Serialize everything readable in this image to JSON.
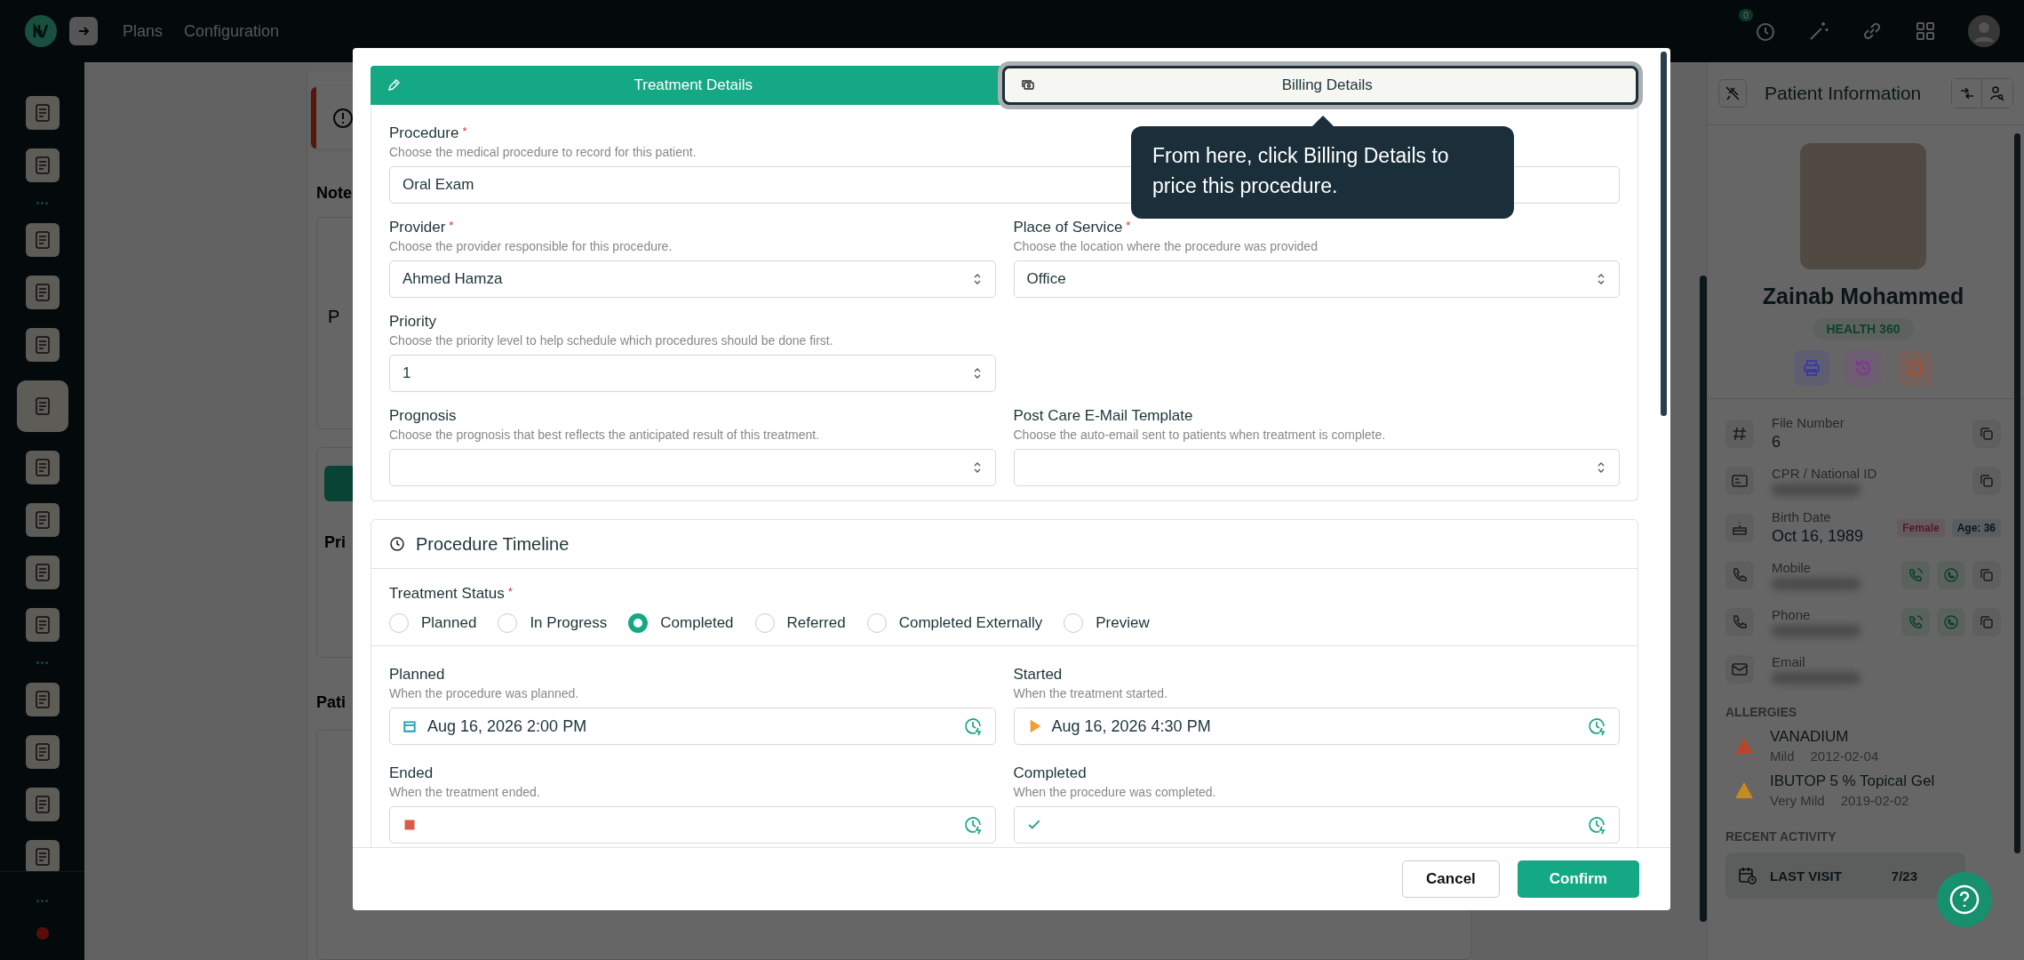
{
  "topbar": {
    "nav": [
      "Plans",
      "Configuration"
    ],
    "timer_badge": "0"
  },
  "sidebar": {
    "items": [
      {
        "kind": "icon",
        "selected": false
      },
      {
        "kind": "icon",
        "selected": false
      },
      {
        "kind": "separator"
      },
      {
        "kind": "icon",
        "selected": false
      },
      {
        "kind": "icon",
        "selected": false
      },
      {
        "kind": "icon",
        "selected": false
      },
      {
        "kind": "icon",
        "selected": true
      },
      {
        "kind": "icon",
        "selected": false
      },
      {
        "kind": "icon",
        "selected": false
      },
      {
        "kind": "icon",
        "selected": false
      },
      {
        "kind": "icon",
        "selected": false
      },
      {
        "kind": "separator"
      },
      {
        "kind": "icon",
        "selected": false
      },
      {
        "kind": "icon",
        "selected": false
      },
      {
        "kind": "icon",
        "selected": false
      },
      {
        "kind": "icon",
        "selected": false
      }
    ]
  },
  "background": {
    "note_label": "Note",
    "card_text": "P",
    "table_header": "Pri",
    "section_label": "Pati"
  },
  "modal": {
    "tabs": [
      {
        "label": "Treatment Details",
        "selected": true,
        "highlighted": false
      },
      {
        "label": "Billing Details",
        "selected": false,
        "highlighted": true
      }
    ],
    "tooltip": {
      "text": "From here, click Billing Details to price this procedure."
    },
    "rows": [
      [
        {
          "label": "Procedure",
          "required_mark": "*",
          "hint": "Choose the medical procedure to record for this patient.",
          "value": "Oral Exam",
          "kind": "text",
          "wide": true
        }
      ],
      [
        {
          "label": "Provider",
          "required_mark": "*",
          "hint": "Choose the provider responsible for this procedure.",
          "value": "Ahmed Hamza",
          "kind": "select",
          "wide": false
        },
        {
          "label": "Place of Service",
          "required_mark": "*",
          "hint": "Choose the location where the procedure was provided",
          "value": "Office",
          "kind": "select",
          "wide": false
        }
      ],
      [
        {
          "label": "Priority",
          "hint": "Choose the priority level to help schedule which procedures should be done first.",
          "value": "1",
          "kind": "select",
          "wide": false
        }
      ],
      [
        {
          "label": "Prognosis",
          "hint": "Choose the prognosis that best reflects the anticipated result of this treatment.",
          "kind": "select",
          "wide": false
        },
        {
          "label": "Post Care E-Mail Template",
          "hint": "Choose the auto-email sent to patients when treatment is complete.",
          "kind": "select",
          "wide": false
        }
      ]
    ],
    "timeline": {
      "title": "Procedure Timeline",
      "status_label": "Treatment Status",
      "status_required_mark": "*",
      "options": [
        {
          "label": "Planned",
          "selected": false
        },
        {
          "label": "In Progress",
          "selected": false
        },
        {
          "label": "Completed",
          "selected": true
        },
        {
          "label": "Referred",
          "selected": false
        },
        {
          "label": "Completed Externally",
          "selected": false
        },
        {
          "label": "Preview",
          "selected": false
        }
      ],
      "dates": [
        {
          "label": "Planned",
          "hint": "When the procedure was planned.",
          "value": "Aug 16, 2026 2:00 PM",
          "color": "#1a9fb0"
        },
        {
          "label": "Started",
          "hint": "When the treatment started.",
          "value": "Aug 16, 2026 4:30 PM",
          "color": "#f0a030"
        },
        {
          "label": "Ended",
          "hint": "When the treatment ended.",
          "color": "#e05a4a"
        },
        {
          "label": "Completed",
          "hint": "When the procedure was completed.",
          "color": "#18a57d"
        }
      ]
    },
    "buttons": [
      {
        "label": "Cancel",
        "kind": "secondary"
      },
      {
        "label": "Confirm",
        "kind": "primary"
      }
    ]
  },
  "patient": {
    "title": "Patient Information",
    "name": "Zainab Mohammed",
    "badge": "HEALTH 360",
    "actions": [
      {
        "color": "#3c3ca0"
      },
      {
        "color": "#86339e"
      },
      {
        "color": "#b04a2c"
      }
    ],
    "info": [
      {
        "kind": "number",
        "label": "File Number",
        "value": "6",
        "blurred": false,
        "actions": [
          {
            "kind": "copy"
          }
        ]
      },
      {
        "kind": "id",
        "label": "CPR / National ID",
        "blurred": true,
        "actions": [
          {
            "kind": "copy"
          }
        ]
      },
      {
        "kind": "date",
        "label": "Birth Date",
        "value": "Oct 16, 1989",
        "blurred": false,
        "tags": [
          {
            "text": "Female",
            "kind": "gender"
          },
          {
            "text": "Age: 36",
            "kind": "age"
          }
        ]
      },
      {
        "kind": "phone",
        "label": "Mobile",
        "blurred": true,
        "actions": [
          {
            "kind": "call"
          },
          {
            "kind": "chat"
          },
          {
            "kind": "copy"
          }
        ]
      },
      {
        "kind": "phone",
        "label": "Phone",
        "blurred": true,
        "actions": [
          {
            "kind": "call"
          },
          {
            "kind": "chat"
          },
          {
            "kind": "copy"
          }
        ]
      },
      {
        "kind": "email",
        "label": "Email",
        "blurred": true
      }
    ],
    "allergies_title": "ALLERGIES",
    "allergies": [
      {
        "name": "VANADIUM",
        "severity": "Mild",
        "date": "2012-02-04",
        "color": "#b8442c"
      },
      {
        "name": "IBUTOP 5 % Topical Gel",
        "severity": "Very Mild",
        "date": "2019-02-02",
        "color": "#c58a22"
      }
    ],
    "activity_title": "RECENT ACTIVITY",
    "activity": [
      {
        "label": "LAST VISIT",
        "value": "7/23"
      }
    ]
  }
}
